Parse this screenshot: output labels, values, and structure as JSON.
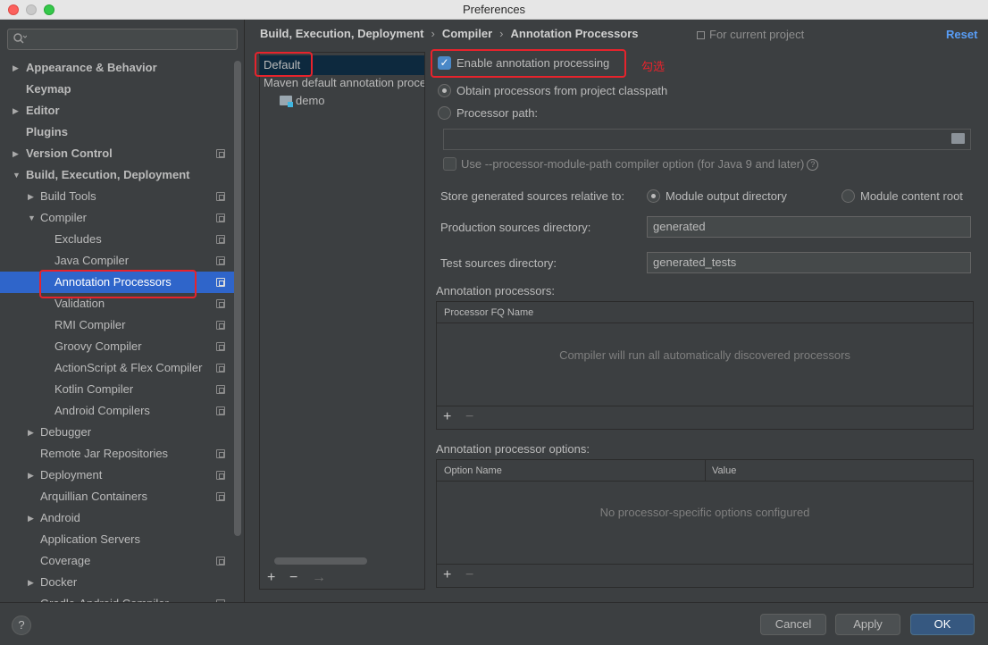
{
  "window": {
    "title": "Preferences"
  },
  "sidebar": {
    "search_placeholder": "",
    "items": [
      {
        "label": "Appearance & Behavior",
        "level": 0,
        "bold": true,
        "expand": "collapsed",
        "copy": false
      },
      {
        "label": "Keymap",
        "level": 0,
        "bold": true,
        "expand": "none",
        "copy": false
      },
      {
        "label": "Editor",
        "level": 0,
        "bold": true,
        "expand": "collapsed",
        "copy": false
      },
      {
        "label": "Plugins",
        "level": 0,
        "bold": true,
        "expand": "none",
        "copy": false
      },
      {
        "label": "Version Control",
        "level": 0,
        "bold": true,
        "expand": "collapsed",
        "copy": true
      },
      {
        "label": "Build, Execution, Deployment",
        "level": 0,
        "bold": true,
        "expand": "expanded",
        "copy": false
      },
      {
        "label": "Build Tools",
        "level": 1,
        "bold": false,
        "expand": "collapsed",
        "copy": true
      },
      {
        "label": "Compiler",
        "level": 1,
        "bold": false,
        "expand": "expanded",
        "copy": true
      },
      {
        "label": "Excludes",
        "level": 2,
        "bold": false,
        "expand": "none",
        "copy": true
      },
      {
        "label": "Java Compiler",
        "level": 2,
        "bold": false,
        "expand": "none",
        "copy": true
      },
      {
        "label": "Annotation Processors",
        "level": 2,
        "bold": false,
        "expand": "none",
        "copy": true,
        "selected": true
      },
      {
        "label": "Validation",
        "level": 2,
        "bold": false,
        "expand": "none",
        "copy": true
      },
      {
        "label": "RMI Compiler",
        "level": 2,
        "bold": false,
        "expand": "none",
        "copy": true
      },
      {
        "label": "Groovy Compiler",
        "level": 2,
        "bold": false,
        "expand": "none",
        "copy": true
      },
      {
        "label": "ActionScript & Flex Compiler",
        "level": 2,
        "bold": false,
        "expand": "none",
        "copy": true
      },
      {
        "label": "Kotlin Compiler",
        "level": 2,
        "bold": false,
        "expand": "none",
        "copy": true
      },
      {
        "label": "Android Compilers",
        "level": 2,
        "bold": false,
        "expand": "none",
        "copy": true
      },
      {
        "label": "Debugger",
        "level": 1,
        "bold": false,
        "expand": "collapsed",
        "copy": false
      },
      {
        "label": "Remote Jar Repositories",
        "level": 1,
        "bold": false,
        "expand": "none",
        "copy": true
      },
      {
        "label": "Deployment",
        "level": 1,
        "bold": false,
        "expand": "collapsed",
        "copy": true
      },
      {
        "label": "Arquillian Containers",
        "level": 1,
        "bold": false,
        "expand": "none",
        "copy": true
      },
      {
        "label": "Android",
        "level": 1,
        "bold": false,
        "expand": "collapsed",
        "copy": false
      },
      {
        "label": "Application Servers",
        "level": 1,
        "bold": false,
        "expand": "none",
        "copy": false
      },
      {
        "label": "Coverage",
        "level": 1,
        "bold": false,
        "expand": "none",
        "copy": true
      },
      {
        "label": "Docker",
        "level": 1,
        "bold": false,
        "expand": "collapsed",
        "copy": false
      },
      {
        "label": "Gradle-Android Compiler",
        "level": 1,
        "bold": false,
        "expand": "none",
        "copy": true
      }
    ]
  },
  "breadcrumb": {
    "parts": [
      "Build, Execution, Deployment",
      "Compiler",
      "Annotation Processors"
    ],
    "separator": "›"
  },
  "scope_label": "For current project",
  "reset_label": "Reset",
  "profiles": {
    "default": "Default",
    "maven": "Maven default annotation processors profile",
    "module": "demo",
    "add": "+",
    "remove": "−",
    "move": "→"
  },
  "settings": {
    "enable_label": "Enable annotation processing",
    "annotation_note": "勾选",
    "obtain_label": "Obtain processors from project classpath",
    "path_label": "Processor path:",
    "path_value": "",
    "module_path_label": "Use --processor-module-path compiler option (for Java 9 and later)",
    "help_glyph": "?",
    "store_label": "Store generated sources relative to:",
    "module_output": "Module output directory",
    "module_content": "Module content root",
    "production_label": "Production sources directory:",
    "production_value": "generated",
    "test_label": "Test sources directory:",
    "test_value": "generated_tests"
  },
  "processors_table": {
    "title": "Annotation processors:",
    "column": "Processor FQ Name",
    "empty": "Compiler will run all automatically discovered processors",
    "add": "+",
    "remove": "−"
  },
  "options_table": {
    "title": "Annotation processor options:",
    "columns": [
      "Option Name",
      "Value"
    ],
    "empty": "No processor-specific options configured",
    "add": "+",
    "remove": "−"
  },
  "footer": {
    "help": "?",
    "cancel": "Cancel",
    "apply": "Apply",
    "ok": "OK"
  },
  "colors": {
    "background": "#3c3f41",
    "selection": "#2f65ca",
    "link": "#589df6",
    "highlight_box": "#e7232c",
    "primary_button": "#365880"
  }
}
